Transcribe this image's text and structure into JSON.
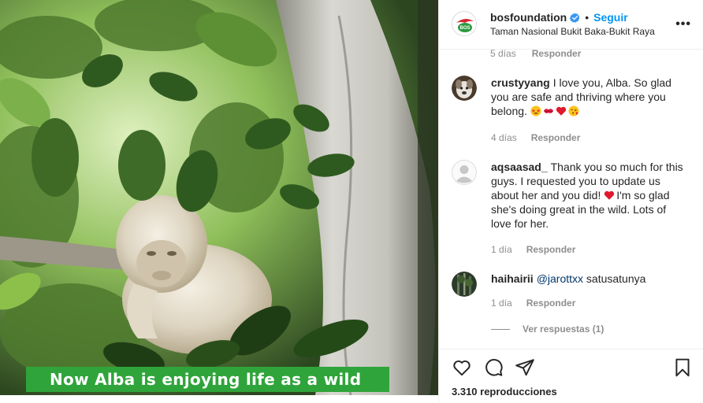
{
  "media": {
    "caption": "Now Alba is enjoying life as a wild",
    "band_color": "#2fa43a"
  },
  "header": {
    "username": "bosfoundation",
    "verified_icon": "verified-badge-icon",
    "separator": "•",
    "follow_label": "Seguir",
    "location": "Taman Nasional Bukit Baka-Bukit Raya",
    "more_label": "•••"
  },
  "partial_comment": {
    "time": "5 días",
    "reply_label": "Responder"
  },
  "comments": [
    {
      "username": "crustyyang",
      "text": "I love you, Alba. So glad you are safe and thriving where you belong.",
      "emojis": [
        "star-struck-face-icon",
        "kiss-mark-icon",
        "red-heart-icon",
        "face-blowing-kiss-icon"
      ],
      "time": "4 días",
      "reply_label": "Responder"
    },
    {
      "username": "aqsaasad_",
      "text_before": "Thank you so much for this guys. I requested you to update us about her and you did!",
      "text_after": "I'm so glad she's doing great in the wild. Lots of love for her.",
      "emoji": "red-heart-icon",
      "time": "1 día",
      "reply_label": "Responder"
    },
    {
      "username": "haihairii",
      "mention": "@jarottxx",
      "text": "satusatunya",
      "time": "1 día",
      "reply_label": "Responder"
    }
  ],
  "view_replies": "Ver respuestas (1)",
  "actions": {
    "views": "3.310 reproducciones"
  },
  "colors": {
    "accent": "#0095f6",
    "meta_text": "#8e8e8e",
    "mention": "#00376b"
  }
}
